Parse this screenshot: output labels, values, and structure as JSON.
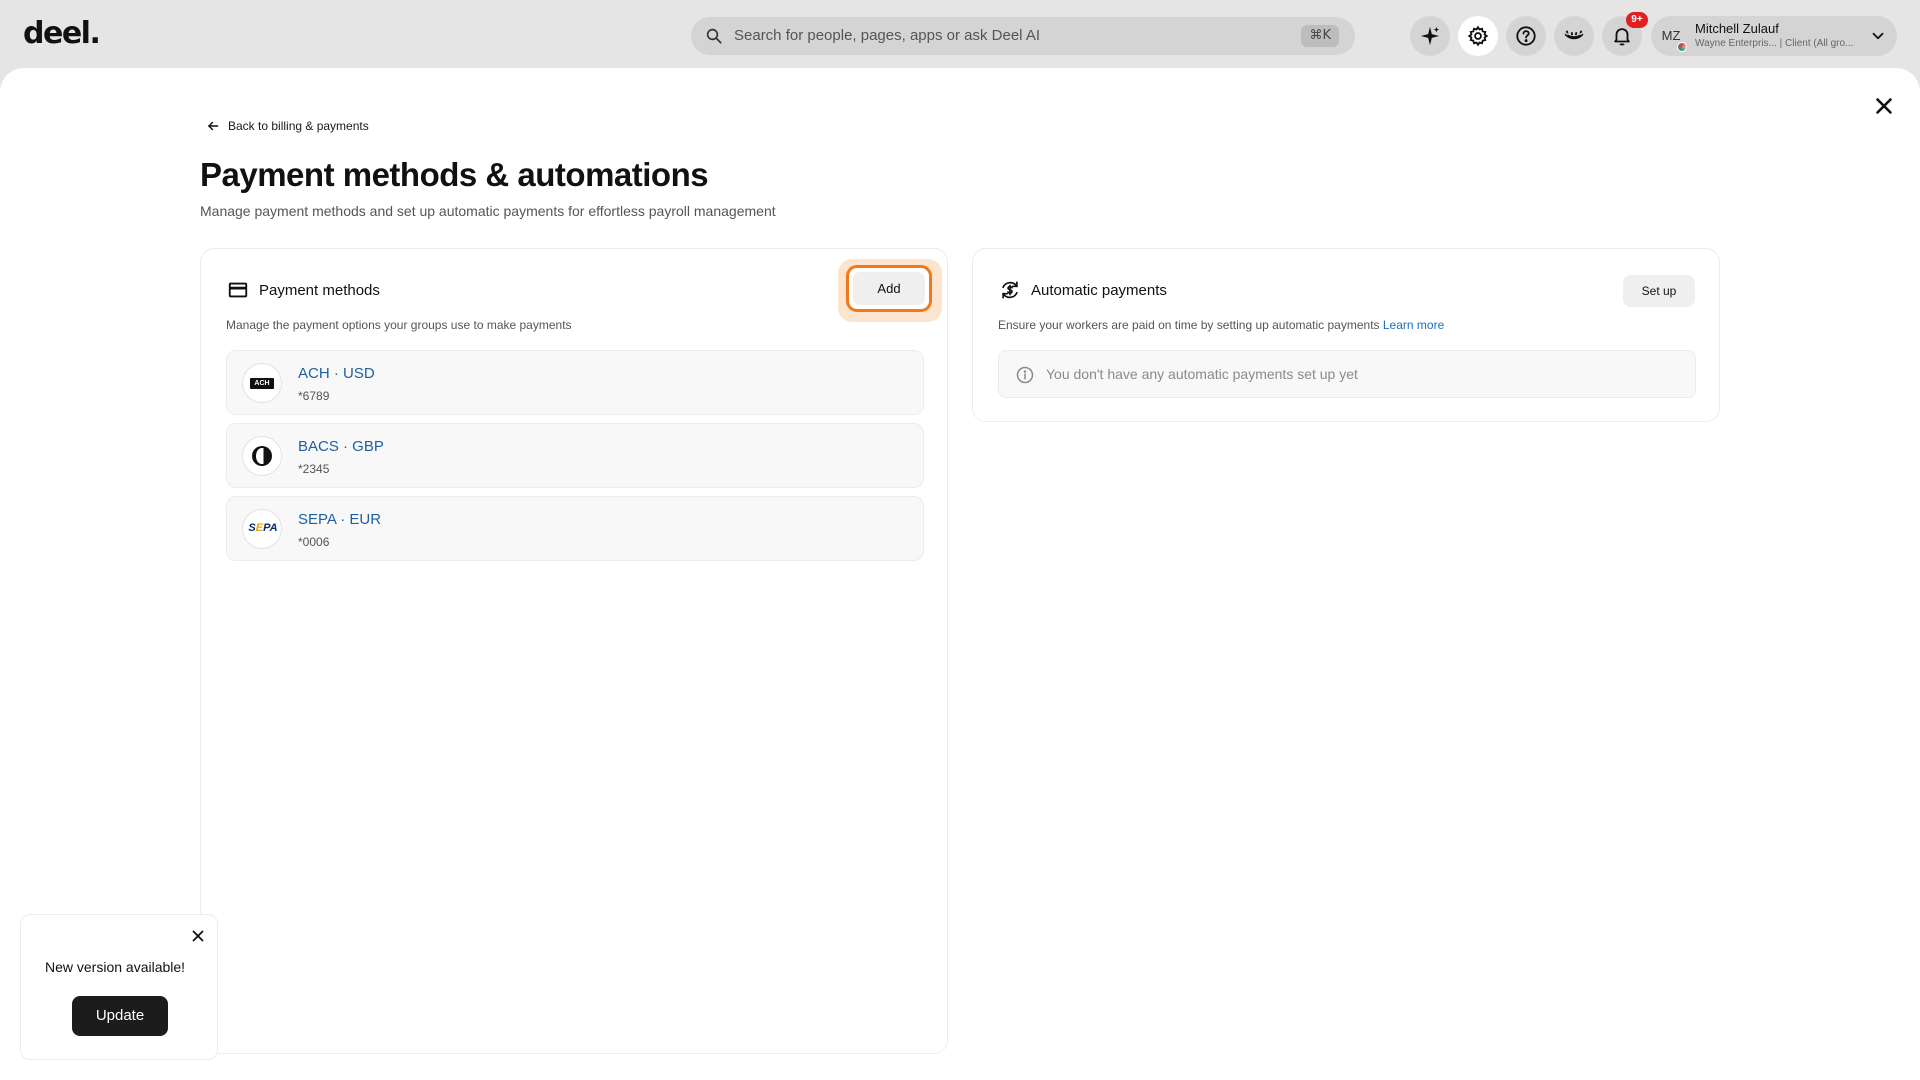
{
  "header": {
    "logo": "deel.",
    "search_placeholder": "Search for people, pages, apps or ask Deel AI",
    "search_shortcut": "⌘K",
    "notifications_badge": "9+",
    "user": {
      "initials": "MZ",
      "name": "Mitchell Zulauf",
      "subtitle": "Wayne Enterpris... | Client (All gro..."
    }
  },
  "page": {
    "back_link": "Back to billing & payments",
    "title": "Payment methods & automations",
    "subtitle": "Manage payment methods and set up automatic payments for effortless payroll management"
  },
  "payment_methods": {
    "title": "Payment methods",
    "description": "Manage the payment options your groups use to make payments",
    "add_label": "Add",
    "items": [
      {
        "name": "ACH · USD",
        "number": "*6789",
        "logo_text": "ACH"
      },
      {
        "name": "BACS · GBP",
        "number": "*2345"
      },
      {
        "name": "SEPA · EUR",
        "number": "*0006",
        "logo_text": "SEPA"
      }
    ]
  },
  "automatic_payments": {
    "title": "Automatic payments",
    "description": "Ensure your workers are paid on time by setting up automatic payments",
    "learn_more": "Learn more",
    "setup_label": "Set up",
    "empty_message": "You don't have any automatic payments set up yet"
  },
  "toast": {
    "message": "New version available!",
    "button_label": "Update"
  },
  "colors": {
    "accent_orange": "#f07a1a",
    "link_blue": "#1f5f9f",
    "badge_red": "#e02020"
  }
}
